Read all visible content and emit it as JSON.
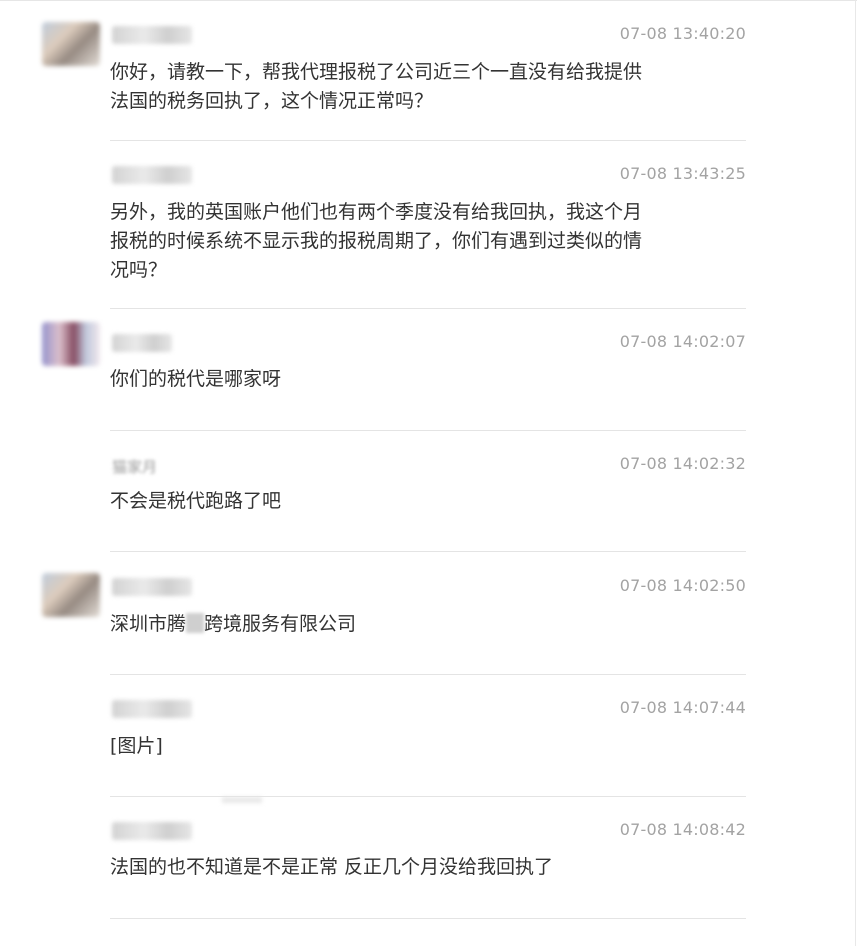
{
  "messages": [
    {
      "time": "07-08 13:40:20",
      "text": "你好，请教一下，帮我代理报税了公司近三个一直没有给我提供\n法国的税务回执了，这个情况正常吗？"
    },
    {
      "time": "07-08 13:43:25",
      "text": "另外，我的英国账户他们也有两个季度没有给我回执，我这个月\n报税的时候系统不显示我的报税周期了，你们有遇到过类似的情\n况吗？"
    },
    {
      "time": "07-08 14:02:07",
      "text": "你们的税代是哪家呀"
    },
    {
      "time": "07-08 14:02:32",
      "name_partial": "猫家月",
      "text": "不会是税代跑路了吧"
    },
    {
      "time": "07-08 14:02:50",
      "text_before": "深圳市腾",
      "text_after": "跨境服务有限公司"
    },
    {
      "time": "07-08 14:07:44",
      "text": "[图片]"
    },
    {
      "time": "07-08 14:08:42",
      "text": "法国的也不知道是不是正常 反正几个月没给我回执了"
    }
  ],
  "icons": {
    "avatar": "user-avatar-icon"
  }
}
